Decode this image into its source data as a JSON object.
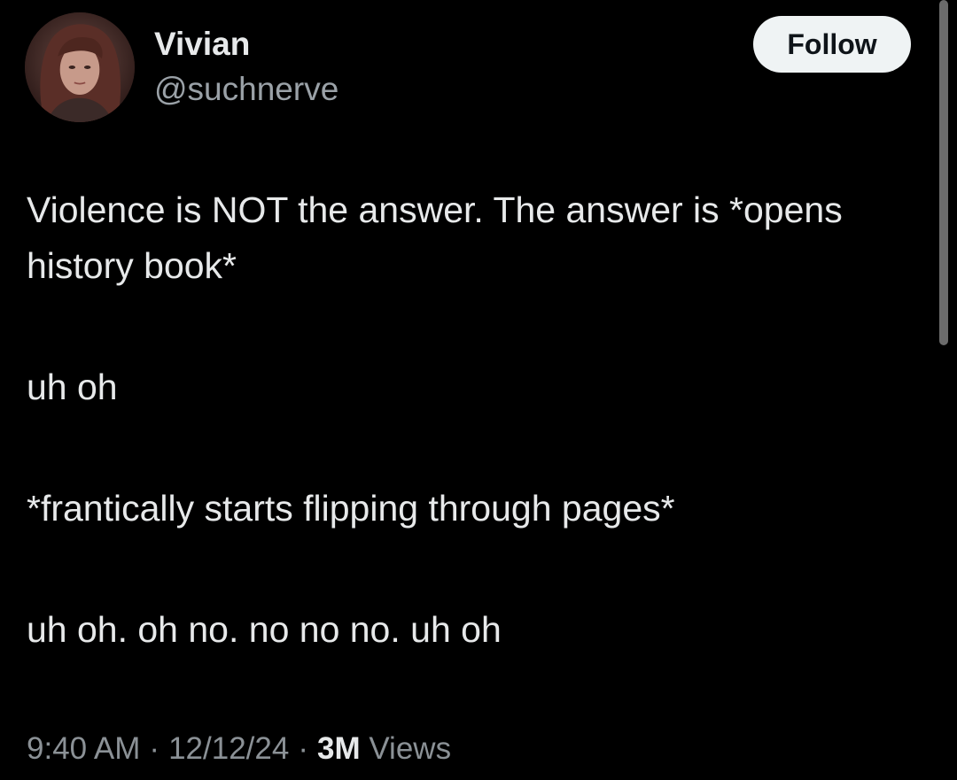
{
  "author": {
    "display_name": "Vivian",
    "handle": "@suchnerve",
    "avatar_icon": "profile-photo"
  },
  "follow_button": {
    "label": "Follow"
  },
  "tweet": {
    "paragraphs": [
      "Violence is NOT the answer. The answer is *opens history book*",
      "uh oh",
      "*frantically starts flipping through pages*",
      "uh oh. oh no. no no no. uh oh"
    ]
  },
  "meta": {
    "time": "9:40 AM",
    "date": "12/12/24",
    "views_count": "3M",
    "views_label": "Views",
    "separator": "·"
  },
  "colors": {
    "background": "#000000",
    "text_primary": "#e7e9ea",
    "text_secondary": "#8b9196",
    "button_bg": "#eff3f4",
    "button_text": "#0f1419"
  }
}
